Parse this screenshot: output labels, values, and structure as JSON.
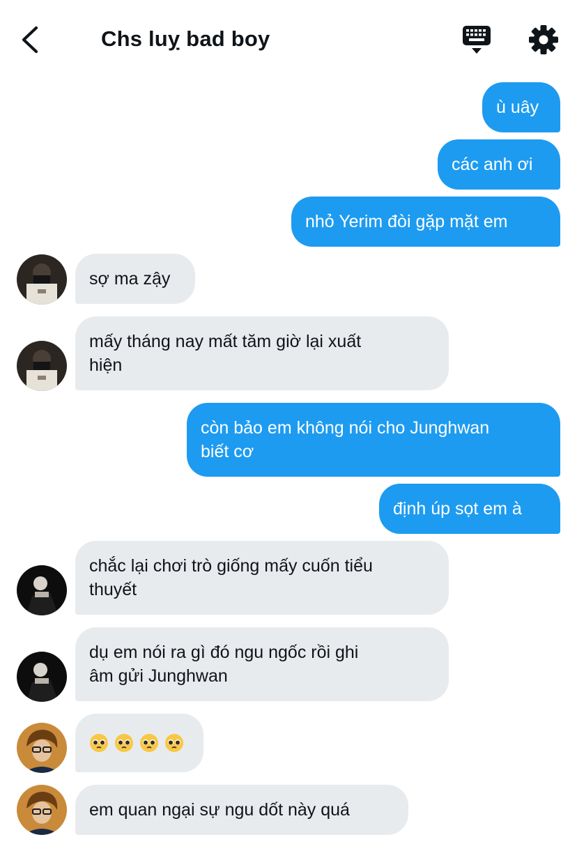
{
  "header": {
    "title": "Chs luỵ bad boy",
    "back_icon": "chevron-left-icon",
    "keyboard_icon": "keyboard-icon",
    "settings_icon": "gear-icon"
  },
  "colors": {
    "outgoing_bubble": "#1d9bf0",
    "incoming_bubble": "#e8ebee",
    "text_dark": "#0f1419"
  },
  "messages": [
    {
      "direction": "out",
      "text": "ù uây"
    },
    {
      "direction": "out",
      "text": "các anh ơi"
    },
    {
      "direction": "out",
      "text": "nhỏ Yerim đòi gặp mặt em"
    },
    {
      "direction": "in",
      "sender": "avatar-1",
      "text": "sợ ma zậy"
    },
    {
      "direction": "in",
      "sender": "avatar-1",
      "lines": [
        "mấy tháng nay mất tăm giờ lại xuất",
        "hiện"
      ]
    },
    {
      "direction": "out",
      "lines": [
        "còn bảo em không nói cho Junghwan",
        "biết cơ"
      ]
    },
    {
      "direction": "out",
      "text": "định úp sọt em à"
    },
    {
      "direction": "in",
      "sender": "avatar-2",
      "lines": [
        "chắc lại chơi trò giống mấy cuốn tiểu",
        "thuyết"
      ]
    },
    {
      "direction": "in",
      "sender": "avatar-2",
      "lines": [
        "dụ em nói ra gì đó ngu ngốc rồi ghi",
        "âm gửi Junghwan"
      ]
    },
    {
      "direction": "in",
      "sender": "avatar-3",
      "emoji": [
        "pleading-face-emoji",
        "pleading-face-emoji",
        "pleading-face-emoji",
        "pleading-face-emoji"
      ]
    },
    {
      "direction": "in",
      "sender": "avatar-3",
      "text": "em quan ngại sự ngu dốt này quá"
    }
  ]
}
